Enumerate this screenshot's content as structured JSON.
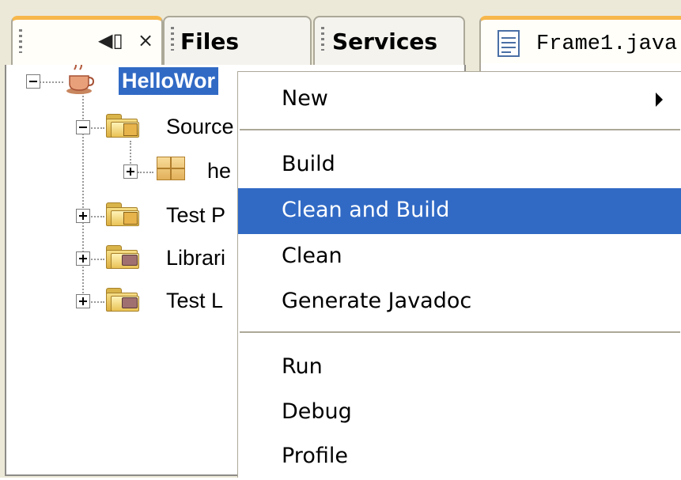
{
  "tabs": {
    "projects": {
      "pin_label": "◀▯",
      "close_label": "×"
    },
    "files": {
      "label": "Files"
    },
    "services": {
      "label": "Services"
    }
  },
  "editor": {
    "tab_label": "Frame1.java"
  },
  "tree": {
    "root": {
      "label": "HelloWor",
      "icon": "java-project-icon"
    },
    "items": [
      {
        "label": "Source",
        "icon": "source-folder-icon"
      },
      {
        "label": "he",
        "icon": "package-icon"
      },
      {
        "label": "Test P",
        "icon": "test-folder-icon"
      },
      {
        "label": "Librari",
        "icon": "library-folder-icon"
      },
      {
        "label": "Test L",
        "icon": "test-library-folder-icon"
      }
    ]
  },
  "context_menu": {
    "items": [
      {
        "label": "New",
        "submenu": true
      },
      {
        "label": "Build"
      },
      {
        "label": "Clean and Build",
        "highlighted": true
      },
      {
        "label": "Clean"
      },
      {
        "label": "Generate Javadoc"
      },
      {
        "label": "Run"
      },
      {
        "label": "Debug"
      },
      {
        "label": "Profile"
      }
    ]
  },
  "colors": {
    "selection": "#316ac5",
    "tab_accent": "#f7b74a",
    "panel_bg": "#ece9d8"
  }
}
